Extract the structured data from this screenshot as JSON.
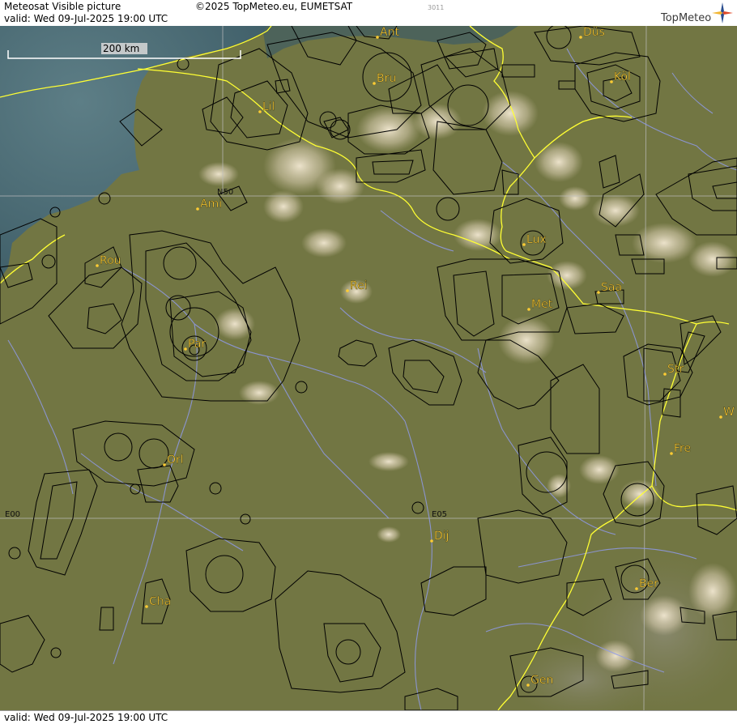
{
  "header": {
    "title": "Meteosat Visible picture",
    "valid": "valid:  Wed  09-Jul-2025  19:00 UTC",
    "copyright": "©2025 TopMeteo.eu, EUMETSAT",
    "image_code": "3011",
    "logo": "TopMeteo"
  },
  "footer": {
    "valid": "valid:  Wed  09-Jul-2025  19:00 UTC"
  },
  "scale_bar": {
    "label": "200 km"
  },
  "grid_labels": [
    {
      "key": "n50",
      "text": "N50"
    },
    {
      "key": "e00",
      "text": "E00"
    },
    {
      "key": "e05",
      "text": "E05"
    }
  ],
  "cities": [
    {
      "key": "ant",
      "name": "Ant"
    },
    {
      "key": "bru",
      "name": "Bru"
    },
    {
      "key": "lil",
      "name": "Lil"
    },
    {
      "key": "dus",
      "name": "Düs"
    },
    {
      "key": "kol",
      "name": "Köl"
    },
    {
      "key": "ami",
      "name": "Ami"
    },
    {
      "key": "rou",
      "name": "Rou"
    },
    {
      "key": "lux",
      "name": "Lux"
    },
    {
      "key": "saa",
      "name": "Saa"
    },
    {
      "key": "rei",
      "name": "Rei"
    },
    {
      "key": "met",
      "name": "Met"
    },
    {
      "key": "par",
      "name": "Par"
    },
    {
      "key": "str",
      "name": "Str"
    },
    {
      "key": "w",
      "name": "W"
    },
    {
      "key": "fre",
      "name": "Fre"
    },
    {
      "key": "orl",
      "name": "Orl"
    },
    {
      "key": "dij",
      "name": "Dij"
    },
    {
      "key": "ber",
      "name": "Ber"
    },
    {
      "key": "cha",
      "name": "Cha"
    },
    {
      "key": "gen",
      "name": "Gen"
    }
  ],
  "colors": {
    "land": "#6f7440",
    "sea": "#4c6a72",
    "border": "#ffff33",
    "river": "#8f9ae8",
    "grid": "#bdbdbd",
    "airspace": "#000000",
    "city_label": "#ffcc33"
  }
}
